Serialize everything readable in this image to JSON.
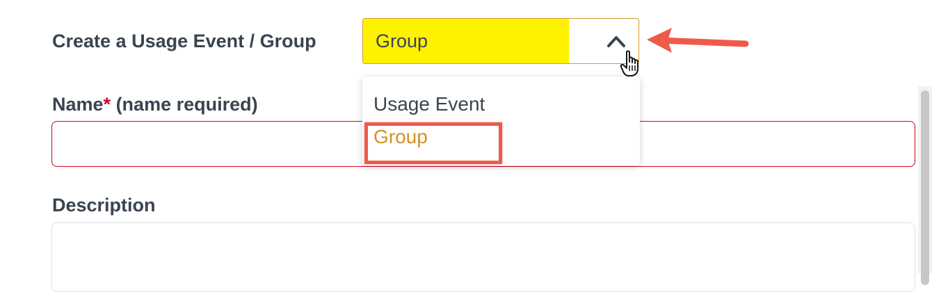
{
  "form": {
    "type_label": "Create a Usage Event / Group",
    "type_select": {
      "value": "Group",
      "expanded": true,
      "options": [
        "Usage Event",
        "Group"
      ],
      "selected_option": "Group"
    },
    "name_label": "Name",
    "name_required_mark": "*",
    "name_required_note": " (name required)",
    "name_value": "",
    "description_label": "Description",
    "description_value": ""
  },
  "colors": {
    "highlight": "#fff200",
    "selected_option": "#d48f26",
    "error_border": "#d0021b",
    "annotation": "#f05a4a"
  },
  "icons": {
    "select_toggle": "chevron-up-icon",
    "pointer": "hand-cursor-icon",
    "annotation_arrow": "red-arrow-icon"
  }
}
